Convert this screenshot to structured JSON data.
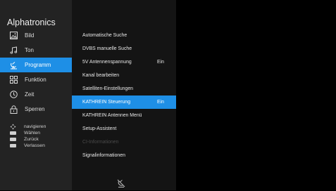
{
  "brand": "Alphatronics",
  "menu": [
    {
      "label": "Bild",
      "icon": "picture-icon",
      "active": false
    },
    {
      "label": "Ton",
      "icon": "music-note-icon",
      "active": false
    },
    {
      "label": "Programm",
      "icon": "antenna-icon",
      "active": true
    },
    {
      "label": "Funktion",
      "icon": "grid-icon",
      "active": false
    },
    {
      "label": "Zeit",
      "icon": "clock-icon",
      "active": false
    },
    {
      "label": "Sperren",
      "icon": "lock-icon",
      "active": false
    }
  ],
  "hints": [
    {
      "label": "navigieren",
      "icon": "dpad-icon"
    },
    {
      "label": "Wählen",
      "icon": "ok-key-icon"
    },
    {
      "label": "Zurück",
      "icon": "back-key-icon"
    },
    {
      "label": "Verlassen",
      "icon": "exit-key-icon"
    }
  ],
  "submenu": [
    {
      "label": "Automatische Suche",
      "value": ""
    },
    {
      "label": "DVBS manuelle Suche",
      "value": ""
    },
    {
      "label": "5V Antennenspannung",
      "value": "Ein"
    },
    {
      "label": "Kanal bearbeiten",
      "value": ""
    },
    {
      "label": "Satelliten-Einstellungen",
      "value": ""
    },
    {
      "label": "KATHREIN Steuerung",
      "value": "Ein",
      "active": true
    },
    {
      "label": "KATHREIN Antennen Menü",
      "value": ""
    },
    {
      "label": "Setup-Assistent",
      "value": ""
    },
    {
      "label": "CI-Informationen",
      "value": "",
      "disabled": true
    },
    {
      "label": "Signalinformationen",
      "value": ""
    }
  ],
  "footer_icon": "no-signal-antenna-icon",
  "colors": {
    "accent": "#1e8fe6",
    "left_panel": "#232323",
    "mid_panel": "#141414"
  }
}
